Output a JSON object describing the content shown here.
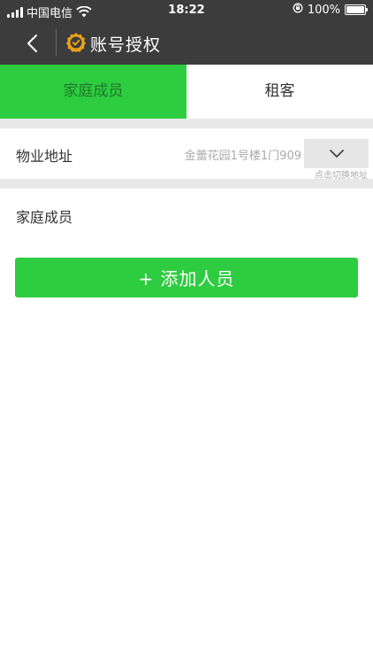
{
  "status_bar": {
    "carrier": "中国电信",
    "time": "18:22",
    "battery": "100%",
    "battery_level": 1.0
  },
  "nav": {
    "title": "账号授权",
    "back_icon": "chevron-left-icon",
    "badge_icon": "verified-badge-icon"
  },
  "tabs": [
    {
      "label": "家庭成员",
      "active": true
    },
    {
      "label": "租客",
      "active": false
    }
  ],
  "address": {
    "label": "物业地址",
    "value": "金蕾花园1号楼1门909",
    "switch_icon": "chevron-down-icon",
    "switch_hint": "点击切换地址"
  },
  "members": {
    "section_title": "家庭成员",
    "add_button": "+ 添加人员"
  },
  "colors": {
    "nav_bg": "#3c3c3c",
    "accent_green": "#2ecc40",
    "badge_orange": "#e8a317"
  }
}
